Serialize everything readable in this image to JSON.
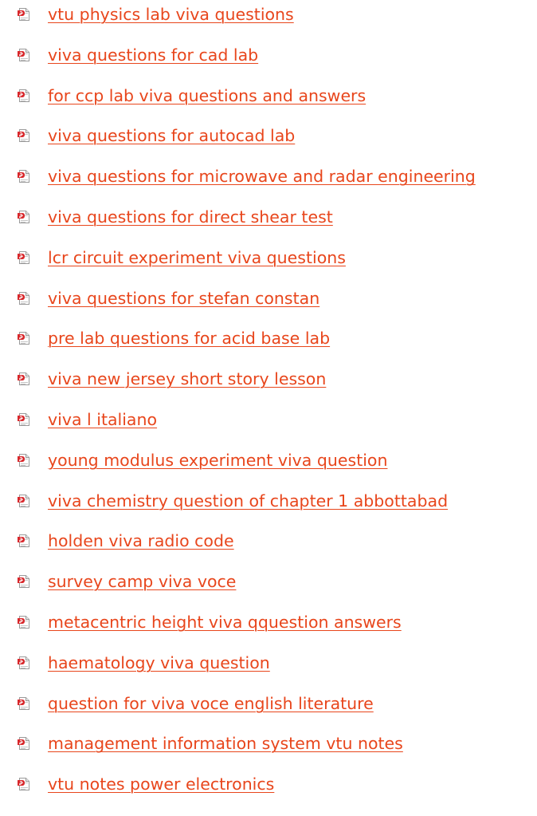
{
  "links": [
    {
      "label": "vtu physics lab viva questions",
      "icon": "pdf-file-icon"
    },
    {
      "label": "viva questions for cad lab",
      "icon": "pdf-file-icon"
    },
    {
      "label": "for ccp lab viva questions and answers",
      "icon": "pdf-file-icon"
    },
    {
      "label": "viva questions for autocad lab",
      "icon": "pdf-file-icon"
    },
    {
      "label": "viva questions for microwave and radar engineering",
      "icon": "pdf-file-icon"
    },
    {
      "label": "viva questions for direct shear test",
      "icon": "pdf-file-icon"
    },
    {
      "label": "lcr circuit experiment viva questions",
      "icon": "pdf-file-icon"
    },
    {
      "label": "viva questions for stefan constan",
      "icon": "pdf-file-icon"
    },
    {
      "label": "pre lab questions for acid base lab",
      "icon": "pdf-file-icon"
    },
    {
      "label": "viva new jersey short story lesson",
      "icon": "pdf-file-icon"
    },
    {
      "label": "viva l italiano",
      "icon": "pdf-file-icon"
    },
    {
      "label": "young modulus experiment viva question",
      "icon": "pdf-file-icon"
    },
    {
      "label": "viva chemistry question of chapter 1 abbottabad",
      "icon": "pdf-file-icon"
    },
    {
      "label": "holden viva radio code",
      "icon": "pdf-file-icon"
    },
    {
      "label": "survey camp viva voce",
      "icon": "pdf-file-icon"
    },
    {
      "label": "metacentric height viva qquestion answers",
      "icon": "pdf-file-icon"
    },
    {
      "label": "haematology viva question",
      "icon": "pdf-file-icon"
    },
    {
      "label": "question for viva voce english literature",
      "icon": "pdf-file-icon"
    },
    {
      "label": "management information system vtu notes",
      "icon": "pdf-file-icon"
    },
    {
      "label": "vtu notes power electronics",
      "icon": "pdf-file-icon"
    }
  ],
  "colors": {
    "link": "#e8461c",
    "pdf_red": "#d8262a"
  }
}
